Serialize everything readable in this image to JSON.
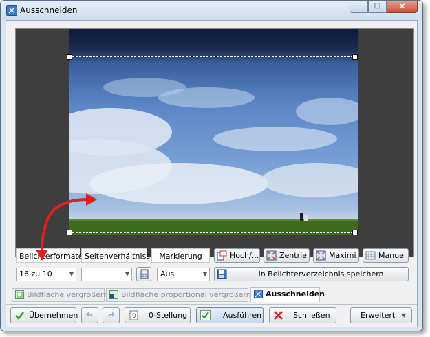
{
  "window": {
    "title": "Ausschneiden"
  },
  "titlebar_buttons": {
    "minimize": "–",
    "maximize": "□",
    "close": "✕"
  },
  "labels": {
    "belichterformate": "Belichterformate",
    "seitenverhaeltnisse": "Seitenverhältnisse",
    "markierung": "Markierung"
  },
  "toolbar": {
    "hoch": "Hoch/...",
    "zentrieren": "Zentrie...",
    "maximieren": "Maximi...",
    "manuell": "Manuell"
  },
  "combos": {
    "format": "16 zu 10",
    "ratio": "",
    "markierung": "Aus"
  },
  "save_button": "In Belichterverzeichnis speichern",
  "tabs": [
    {
      "label": "Bildfläche vergrößern",
      "active": false
    },
    {
      "label": "Bildfläche proportional vergrößern",
      "active": false
    },
    {
      "label": "Ausschneiden",
      "active": true
    }
  ],
  "bottom": {
    "uebernehmen": "Übernehmen",
    "nullstellung": "0-Stellung",
    "ausfuehren": "Ausführen",
    "schliessen": "Schließen",
    "erweitert": "Erweitert"
  },
  "colors": {
    "accent_red": "#e02020",
    "check_green": "#2e9b2e",
    "close_red": "#d0302a"
  }
}
